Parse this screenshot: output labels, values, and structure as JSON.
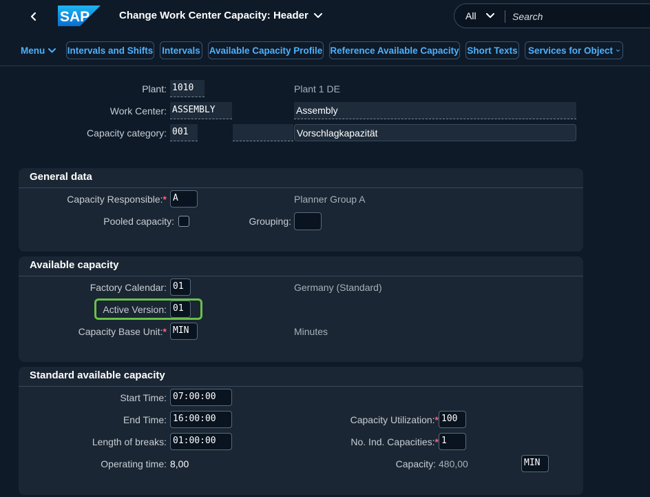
{
  "shell": {
    "title": "Change Work Center Capacity: Header",
    "logo_text": "SAP",
    "search_scope": "All",
    "search_placeholder": "Search"
  },
  "toolbar": {
    "menu": "Menu",
    "intervals_shifts": "Intervals and Shifts",
    "intervals": "Intervals",
    "available_capacity_profile": "Available Capacity Profile",
    "reference_available_capacity": "Reference Available Capacity",
    "short_texts": "Short Texts",
    "services_for_object": "Services for Object"
  },
  "header": {
    "plant_label": "Plant:",
    "plant_value": "1010",
    "plant_desc": "Plant 1 DE",
    "work_center_label": "Work Center:",
    "work_center_value": "ASSEMBLY",
    "work_center_desc": "Assembly",
    "capacity_category_label": "Capacity category:",
    "capacity_category_value": "001",
    "capacity_category_extra": "",
    "capacity_category_desc": "Vorschlagkapazität"
  },
  "general_data": {
    "title": "General data",
    "capacity_responsible_label": "Capacity Responsible:",
    "capacity_responsible_value": "A",
    "capacity_responsible_desc": "Planner Group A",
    "pooled_capacity_label": "Pooled capacity:",
    "grouping_label": "Grouping:",
    "grouping_value": ""
  },
  "available_capacity": {
    "title": "Available capacity",
    "factory_calendar_label": "Factory Calendar:",
    "factory_calendar_value": "01",
    "factory_calendar_desc": "Germany (Standard)",
    "active_version_label": "Active Version:",
    "active_version_value": "01",
    "capacity_base_unit_label": "Capacity Base Unit:",
    "capacity_base_unit_value": "MIN",
    "capacity_base_unit_desc": "Minutes"
  },
  "standard_available_capacity": {
    "title": "Standard available capacity",
    "start_time_label": "Start Time:",
    "start_time_value": "07:00:00",
    "end_time_label": "End Time:",
    "end_time_value": "16:00:00",
    "length_breaks_label": "Length of breaks:",
    "length_breaks_value": "01:00:00",
    "operating_time_label": "Operating time:",
    "operating_time_value": "8,00",
    "capacity_utilization_label": "Capacity Utilization:",
    "capacity_utilization_value": "100",
    "no_ind_capacities_label": "No. Ind. Capacities:",
    "no_ind_capacities_value": "1",
    "capacity_label": "Capacity:",
    "capacity_value": "480,00",
    "capacity_unit_value": "MIN"
  },
  "colors": {
    "background": "#0e1a28",
    "section": "#1a2633",
    "link": "#4db1ff",
    "required": "#ff5e7e",
    "highlight": "#6ac04a"
  }
}
